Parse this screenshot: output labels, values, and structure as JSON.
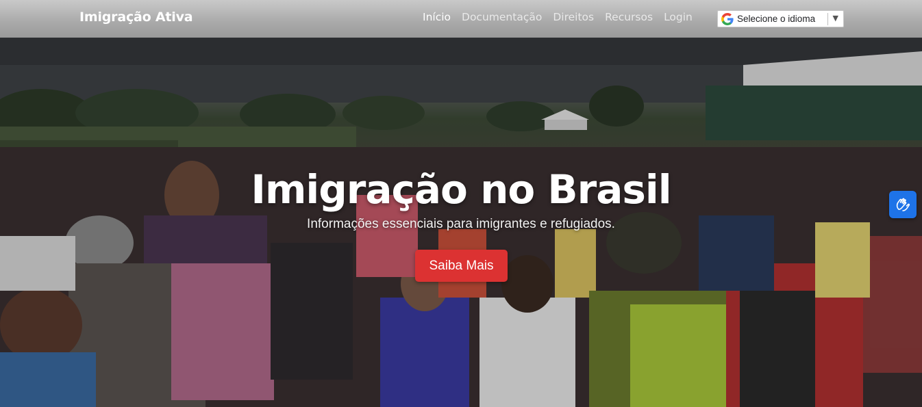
{
  "navbar": {
    "brand": "Imigração Ativa",
    "links": [
      {
        "label": "Início",
        "active": true
      },
      {
        "label": "Documentação",
        "active": false
      },
      {
        "label": "Direitos",
        "active": false
      },
      {
        "label": "Recursos",
        "active": false
      },
      {
        "label": "Login",
        "active": false
      }
    ],
    "language_select": {
      "label": "Selecione o idioma",
      "icon": "google-g-icon",
      "arrow": "▼"
    }
  },
  "hero": {
    "title": "Imigração no Brasil",
    "subtitle": "Informações essenciais para imigrantes e refugiados.",
    "cta_label": "Saiba Mais",
    "background": "crowd-of-immigrants-photo"
  },
  "accessibility": {
    "icon": "sign-language-hands-icon"
  },
  "colors": {
    "cta": "#dc3232",
    "accessibility": "#1e73e8",
    "nav_text": "#ffffff"
  }
}
